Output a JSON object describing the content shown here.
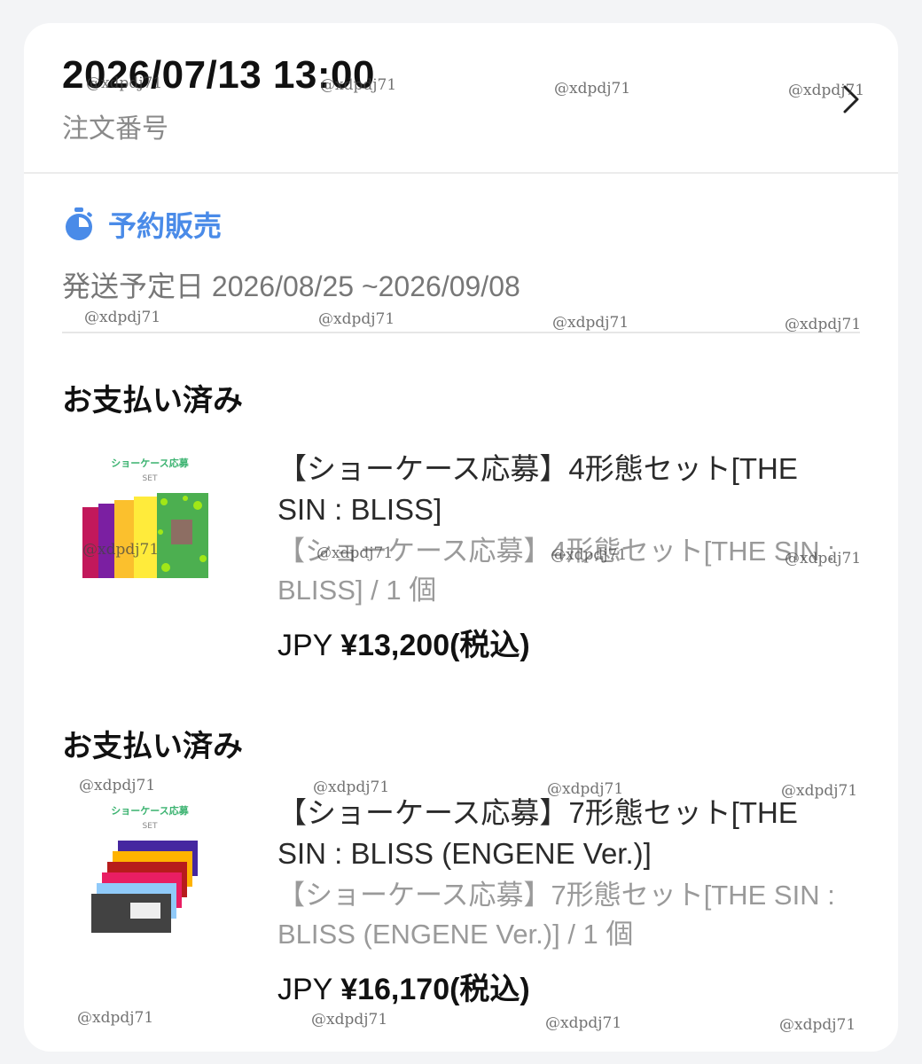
{
  "order": {
    "date": "2026/07/13 13:00",
    "number_label": "注文番号"
  },
  "preorder": {
    "label": "予約販売",
    "ship_text": "発送予定日 2026/08/25 ~2026/09/08"
  },
  "items": [
    {
      "status": "お支払い済み",
      "thumb_title": "ショーケース応募",
      "thumb_set": "SET",
      "title": "【ショーケース応募】4形態セット[THE SIN : BLISS]",
      "sub": "【ショーケース応募】4形態セット[THE SIN : BLISS] / 1 個",
      "currency": "JPY",
      "price": "¥13,200(税込)"
    },
    {
      "status": "お支払い済み",
      "thumb_title": "ショーケース応募",
      "thumb_set": "SET",
      "title": "【ショーケース応募】7形態セット[THE SIN : BLISS (ENGENE Ver.)]",
      "sub": "【ショーケース応募】7形態セット[THE SIN : BLISS (ENGENE Ver.)] / 1 個",
      "currency": "JPY",
      "price": "¥16,170(税込)"
    }
  ],
  "watermark": "@xdpdj71",
  "colors": {
    "accent": "#4a8be8",
    "text": "#111111",
    "muted": "#9a9a9a",
    "background": "#f3f4f6"
  }
}
